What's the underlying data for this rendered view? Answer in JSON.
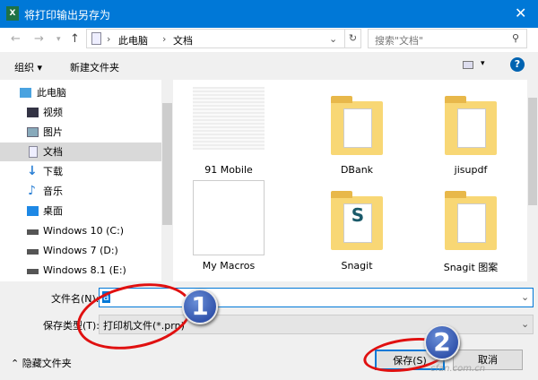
{
  "window": {
    "title": "将打印输出另存为",
    "app_icon": "X",
    "close": "✕"
  },
  "address": {
    "path": [
      "此电脑",
      "文档"
    ],
    "search_placeholder": "搜索\"文档\""
  },
  "toolbar": {
    "organize": "组织 ▾",
    "new_folder": "新建文件夹",
    "help": "?"
  },
  "sidebar": {
    "items": [
      {
        "label": "此电脑",
        "icon": "computer-icon"
      },
      {
        "label": "视频",
        "icon": "video-icon"
      },
      {
        "label": "图片",
        "icon": "pictures-icon"
      },
      {
        "label": "文档",
        "icon": "document-icon",
        "selected": true
      },
      {
        "label": "下载",
        "icon": "download-icon"
      },
      {
        "label": "音乐",
        "icon": "music-icon"
      },
      {
        "label": "桌面",
        "icon": "desktop-icon"
      },
      {
        "label": "Windows 10 (C:)",
        "icon": "drive-icon"
      },
      {
        "label": "Windows 7 (D:)",
        "icon": "drive-icon"
      },
      {
        "label": "Windows 8.1 (E:)",
        "icon": "drive-icon"
      }
    ]
  },
  "files": [
    {
      "name": "91 Mobile",
      "type": "image"
    },
    {
      "name": "DBank",
      "type": "folder"
    },
    {
      "name": "jisupdf",
      "type": "folder"
    },
    {
      "name": "My Macros",
      "type": "blank"
    },
    {
      "name": "Snagit",
      "type": "folder"
    },
    {
      "name": "Snagit 图案",
      "type": "folder"
    }
  ],
  "form": {
    "filename_label": "文件名(N):",
    "filename_value": "a",
    "filetype_label": "保存类型(T):",
    "filetype_value": "打印机文件(*.prn)"
  },
  "footer": {
    "hide_folders": "隐藏文件夹",
    "save": "保存(S)",
    "cancel": "取消",
    "watermark": "cfan.com.cn"
  },
  "annotations": {
    "badge1": "1",
    "badge2": "2"
  }
}
